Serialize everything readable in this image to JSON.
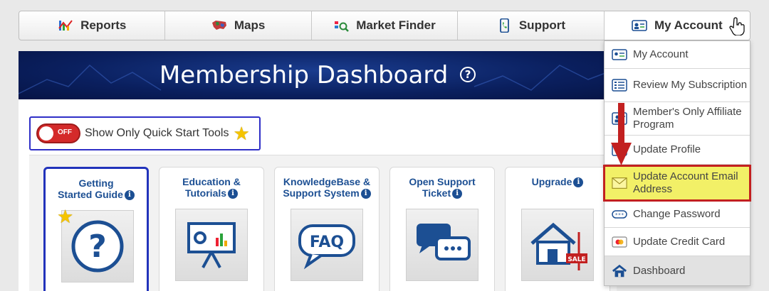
{
  "nav": {
    "items": [
      {
        "label": "Reports",
        "icon": "reports-chart-icon"
      },
      {
        "label": "Maps",
        "icon": "usa-map-icon"
      },
      {
        "label": "Market Finder",
        "icon": "market-finder-icon"
      },
      {
        "label": "Support",
        "icon": "phone-icon"
      },
      {
        "label": "My Account",
        "icon": "account-card-icon"
      }
    ]
  },
  "banner": {
    "title": "Membership Dashboard",
    "help": "?"
  },
  "quickstart": {
    "toggle_state": "OFF",
    "label": "Show Only Quick Start Tools"
  },
  "tiles": [
    {
      "line1": "Getting",
      "line2": "Started Guide",
      "icon": "question-mark-icon"
    },
    {
      "line1": "Education &",
      "line2": "Tutorials",
      "icon": "presentation-board-icon"
    },
    {
      "line1": "KnowledgeBase &",
      "line2": "Support System",
      "icon": "faq-bubble-icon"
    },
    {
      "line1": "Open Support",
      "line2": "Ticket",
      "icon": "chat-bubbles-icon"
    },
    {
      "line1": "Upgrade",
      "line2": "",
      "icon": "house-sale-icon"
    }
  ],
  "dropdown": {
    "items": [
      {
        "label": "My Account"
      },
      {
        "label": "Review My Subscription"
      },
      {
        "label": "Member's Only Affiliate Program"
      },
      {
        "label": "Update Profile"
      },
      {
        "label": "Update Account Email Address"
      },
      {
        "label": "Change Password"
      },
      {
        "label": "Update Credit Card"
      },
      {
        "label": "Dashboard"
      }
    ]
  },
  "colors": {
    "accent_blue": "#1c4f93",
    "highlight": "#f2f067",
    "annotation_red": "#c22020"
  }
}
